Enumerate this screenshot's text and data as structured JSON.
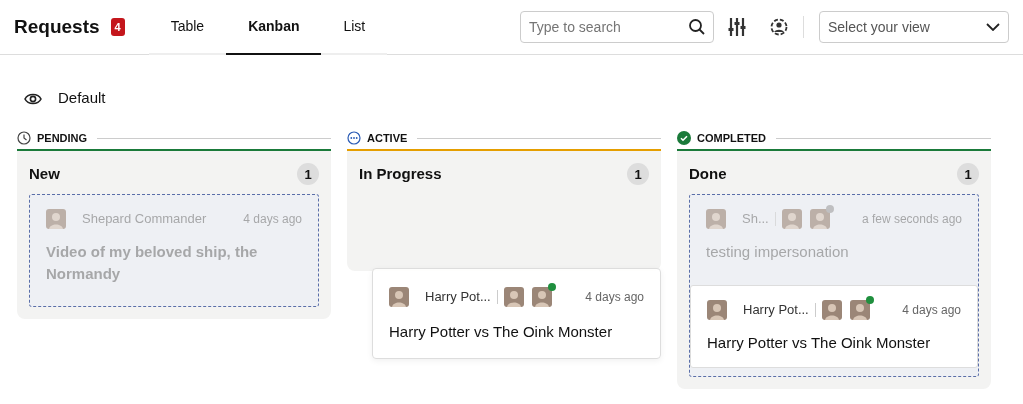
{
  "header": {
    "title": "Requests",
    "badge": "4",
    "tabs": [
      {
        "label": "Table",
        "selected": false
      },
      {
        "label": "Kanban",
        "selected": true
      },
      {
        "label": "List",
        "selected": false
      }
    ],
    "search": {
      "placeholder": "Type to search"
    },
    "view_select": {
      "placeholder": "Select your view"
    }
  },
  "view": {
    "label": "Default"
  },
  "columns": [
    {
      "group": "PENDING",
      "kind": "pending",
      "title": "New",
      "count": "1",
      "drop_zone": true,
      "cards": [
        {
          "author": "Shepard Commander",
          "time": "4 days ago",
          "title": "Video of my beloved ship, the Normandy",
          "faded": true
        }
      ]
    },
    {
      "group": "ACTIVE",
      "kind": "active",
      "title": "In Progress",
      "count": "1",
      "drop_zone": false
    },
    {
      "group": "COMPLETED",
      "kind": "completed",
      "title": "Done",
      "count": "1",
      "drop_zone": true,
      "cards": [
        {
          "author": "Sh...",
          "time": "a few seconds ago",
          "title": "testing impersonation",
          "faded": true,
          "assignees": [
            {
              "status_dot": false
            },
            {
              "status_dot": true,
              "online": false
            }
          ]
        },
        {
          "author": "Harry Pot...",
          "time": "4 days ago",
          "title": "Harry Potter vs The Oink Monster",
          "faded": false,
          "assignees": [
            {
              "status_dot": false
            },
            {
              "status_dot": true,
              "online": true
            }
          ]
        }
      ]
    }
  ],
  "dragged_card": {
    "author": "Harry Pot...",
    "time": "4 days ago",
    "title": "Harry Potter vs The Oink Monster",
    "assignees": [
      {
        "status_dot": false
      },
      {
        "status_dot": true,
        "online": true
      }
    ]
  }
}
